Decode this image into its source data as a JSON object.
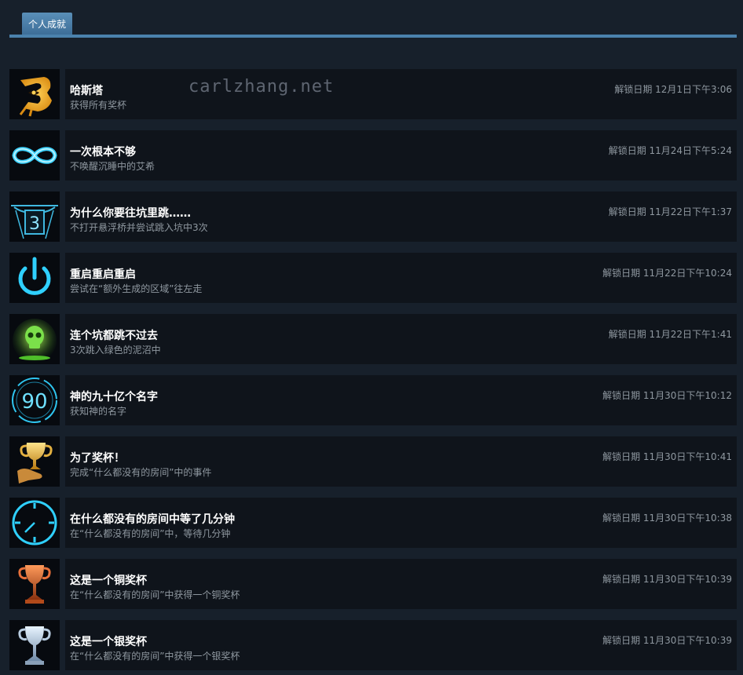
{
  "tab": {
    "label": "个人成就"
  },
  "watermark": "carlzhang.net",
  "achievements": [
    {
      "title": "哈斯塔",
      "desc": "获得所有奖杯",
      "date": "解锁日期 12月1日下午3:06",
      "icon": "hastur-emblem-icon"
    },
    {
      "title": "一次根本不够",
      "desc": "不唤醒沉睡中的艾希",
      "date": "解锁日期 11月24日下午5:24",
      "icon": "infinity-icon"
    },
    {
      "title": "为什么你要往坑里跳……",
      "desc": "不打开悬浮桥并尝试跳入坑中3次",
      "date": "解锁日期 11月22日下午1:37",
      "icon": "pit-three-icon"
    },
    {
      "title": "重启重启重启",
      "desc": "尝试在“额外生成的区域”往左走",
      "date": "解锁日期 11月22日下午10:24",
      "icon": "power-icon"
    },
    {
      "title": "连个坑都跳不过去",
      "desc": "3次跳入绿色的泥沼中",
      "date": "解锁日期 11月22日下午1:41",
      "icon": "green-skull-icon"
    },
    {
      "title": "神的九十亿个名字",
      "desc": "获知神的名字",
      "date": "解锁日期 11月30日下午10:12",
      "icon": "ninety-icon"
    },
    {
      "title": "为了奖杯！",
      "desc": "完成“什么都没有的房间”中的事件",
      "date": "解锁日期 11月30日下午10:41",
      "icon": "gold-trophy-hand-icon"
    },
    {
      "title": "在什么都没有的房间中等了几分钟",
      "desc": "在“什么都没有的房间”中，等待几分钟",
      "date": "解锁日期 11月30日下午10:38",
      "icon": "clock-icon"
    },
    {
      "title": "这是一个铜奖杯",
      "desc": "在“什么都没有的房间”中获得一个铜奖杯",
      "date": "解锁日期 11月30日下午10:39",
      "icon": "bronze-trophy-icon"
    },
    {
      "title": "这是一个银奖杯",
      "desc": "在“什么都没有的房间”中获得一个银奖杯",
      "date": "解锁日期 11月30日下午10:39",
      "icon": "silver-trophy-icon"
    }
  ]
}
